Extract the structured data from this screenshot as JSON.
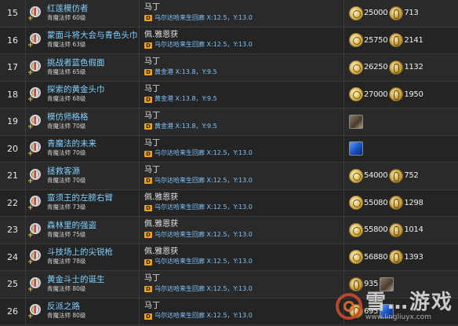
{
  "rows": [
    {
      "num": "15",
      "name": "红莲模仿者",
      "level": "青魔法师 60级",
      "npc": "马丁",
      "location": "乌尔达哈来生回廊 X:12.5，Y:13.0",
      "rewards": [
        {
          "type": "exp",
          "value": "25000"
        },
        {
          "type": "gil",
          "value": "713"
        }
      ]
    },
    {
      "num": "16",
      "name": "蒙面斗将大会与青色头巾",
      "level": "青魔法师 63级",
      "npc": "佩.雅恩获",
      "location": "乌尔达哈来生回廊 X:12.5，Y:13.0",
      "rewards": [
        {
          "type": "exp",
          "value": "25750"
        },
        {
          "type": "gil",
          "value": "2141"
        }
      ]
    },
    {
      "num": "17",
      "name": "挑战者蓝色假面",
      "level": "青魔法师 65级",
      "npc": "马丁",
      "location": "黄金港 X:13.8，Y:9.5",
      "rewards": [
        {
          "type": "exp",
          "value": "26250"
        },
        {
          "type": "gil",
          "value": "1132"
        }
      ]
    },
    {
      "num": "18",
      "name": "探索的黄金头巾",
      "level": "青魔法师 68级",
      "npc": "马丁",
      "location": "黄金港 X:13.8，Y:9.5",
      "rewards": [
        {
          "type": "exp",
          "value": "27000"
        },
        {
          "type": "gil",
          "value": "1950"
        }
      ]
    },
    {
      "num": "19",
      "name": "模仿师格格",
      "level": "青魔法师 70级",
      "npc": "马丁",
      "location": "黄金港 X:13.8，Y:9.5",
      "rewards": [
        {
          "type": "item-brown",
          "value": ""
        }
      ]
    },
    {
      "num": "20",
      "name": "青魔法的未来",
      "level": "青魔法师 70级",
      "npc": "马丁",
      "location": "乌尔达哈来生回廊 X:12.5，Y:13.0",
      "rewards": [
        {
          "type": "item-blue",
          "value": ""
        }
      ]
    },
    {
      "num": "21",
      "name": "拯救客源",
      "level": "青魔法师 70级",
      "npc": "马丁",
      "location": "乌尔达哈来生回廊 X:12.5，Y:13.0",
      "rewards": [
        {
          "type": "exp",
          "value": "54000"
        },
        {
          "type": "gil",
          "value": "752"
        }
      ]
    },
    {
      "num": "22",
      "name": "蛮须王的左膀右臂",
      "level": "青魔法师 73级",
      "npc": "佩.雅恩获",
      "location": "乌尔达哈来生回廊 X:12.5，Y:13.0",
      "rewards": [
        {
          "type": "exp",
          "value": "55080"
        },
        {
          "type": "gil",
          "value": "1298"
        }
      ]
    },
    {
      "num": "23",
      "name": "森林里的强盗",
      "level": "青魔法师 75级",
      "npc": "佩.雅恩获",
      "location": "乌尔达哈来生回廊 X:12.5，Y:13.0",
      "rewards": [
        {
          "type": "exp",
          "value": "55800"
        },
        {
          "type": "gil",
          "value": "1014"
        }
      ]
    },
    {
      "num": "24",
      "name": "斗技场上的尖锐枪",
      "level": "青魔法师 78级",
      "npc": "佩.雅恩获",
      "location": "乌尔达哈来生回廊 X:12.5，Y:13.0",
      "rewards": [
        {
          "type": "exp",
          "value": "56880"
        },
        {
          "type": "gil",
          "value": "1393"
        }
      ]
    },
    {
      "num": "25",
      "name": "黄金斗士的诞生",
      "level": "青魔法师 80级",
      "npc": "马丁",
      "location": "乌尔达哈来生回廊 X:12.5，Y:13.0",
      "rewards": [
        {
          "type": "gil",
          "value": "935"
        },
        {
          "type": "item-brown",
          "value": ""
        }
      ]
    },
    {
      "num": "26",
      "name": "反派之路",
      "level": "青魔法师 80级",
      "npc": "马丁",
      "location": "乌尔达哈来生回廊 X:12.5，Y:13.0",
      "rewards": [
        {
          "type": "gil",
          "value": "695"
        },
        {
          "type": "item-blue",
          "value": ""
        }
      ]
    }
  ],
  "watermark": {
    "title": "雪…游戏",
    "url": "www.lingliuyx.com"
  }
}
